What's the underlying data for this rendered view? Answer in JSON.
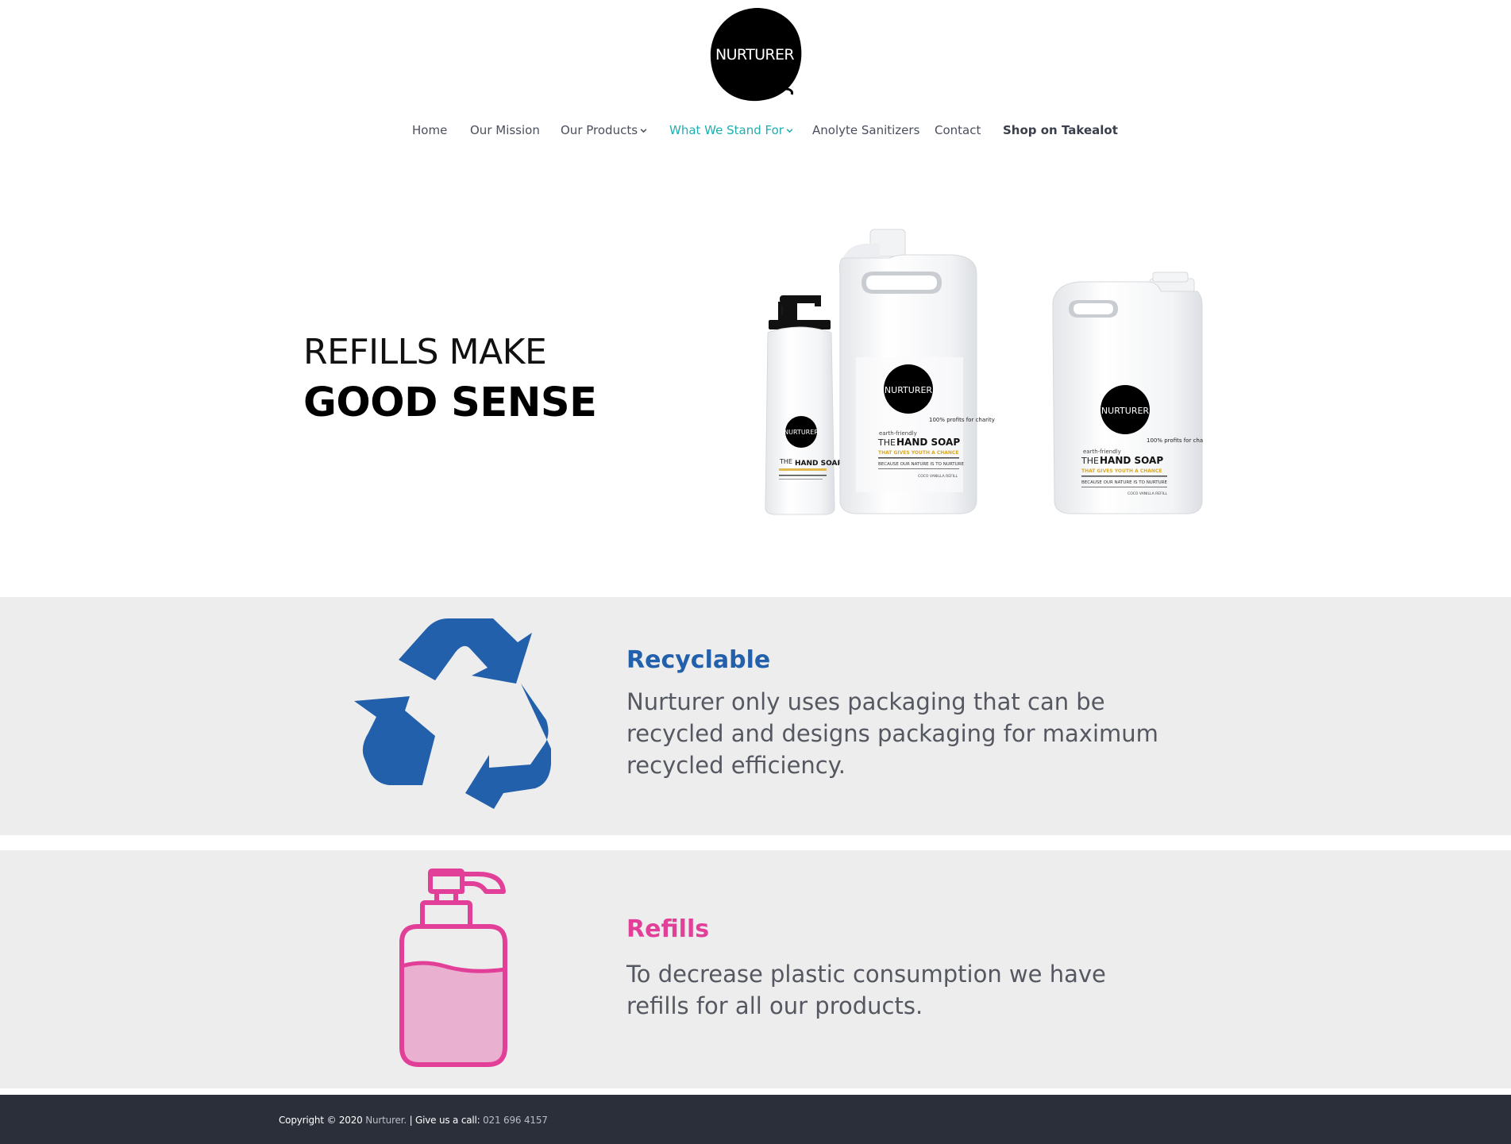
{
  "brand": {
    "logo_text": "NURTURER"
  },
  "nav": {
    "items": [
      {
        "label": "Home"
      },
      {
        "label": "Our Mission"
      },
      {
        "label": "Our Products"
      },
      {
        "label": "What We Stand For"
      },
      {
        "label": "Anolyte Sanitizers"
      },
      {
        "label": "Contact"
      },
      {
        "label": "Shop on Takealot"
      }
    ],
    "active_item": "What We Stand For",
    "colors": {
      "default": "#4a4f5e",
      "active": "#1eaeb0"
    }
  },
  "hero": {
    "title_line1": "REFILLS MAKE",
    "title_line2": "GOOD SENSE",
    "product_labels": {
      "brand": "NURTURER",
      "tagline": "100% profits for charity",
      "eco": "earth-friendly",
      "the": "THE",
      "product": "HAND SOAP",
      "subtitle": "THAT GIVES YOUTH A CHANCE",
      "slogan": "BECAUSE OUR NATURE IS TO NURTURE",
      "variant": "COCO VANILLA REFILL"
    }
  },
  "features": [
    {
      "icon": "recycle-icon",
      "title": "Recyclable",
      "text": "Nurturer only uses packaging that can be recycled and designs packaging for maximum recycled efficiency.",
      "color": "#2360ac"
    },
    {
      "icon": "soap-dispenser-icon",
      "title": "Refills",
      "text": "To decrease plastic consumption we have refills for all our products.",
      "color": "#e23f98"
    }
  ],
  "footer": {
    "copyright": "Copyright © 2020",
    "company": "Nurturer.",
    "separator": "| Give us a call:",
    "phone": "021 696 4157"
  }
}
